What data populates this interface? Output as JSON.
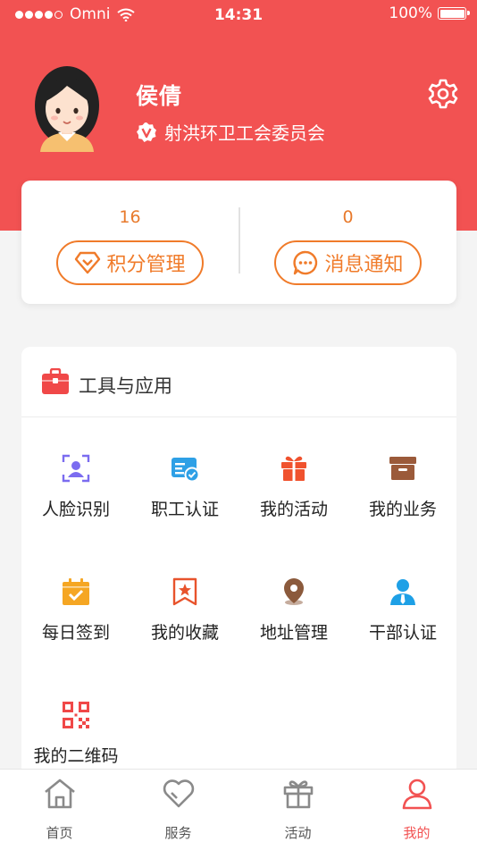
{
  "status_bar": {
    "carrier": "Omni",
    "time": "14:31",
    "battery": "100%"
  },
  "profile": {
    "name": "侯倩",
    "organization": "射洪环卫工会委员会"
  },
  "stats": [
    {
      "value": "16",
      "label": "积分管理",
      "icon": "diamond-icon"
    },
    {
      "value": "0",
      "label": "消息通知",
      "icon": "chat-bubble-icon"
    }
  ],
  "tools": {
    "title": "工具与应用",
    "items": [
      {
        "label": "人脸识别",
        "icon": "face-scan-icon",
        "color": "#7b6cf0"
      },
      {
        "label": "职工认证",
        "icon": "id-card-check-icon",
        "color": "#2ea0e6"
      },
      {
        "label": "我的活动",
        "icon": "gift-icon",
        "color": "#f0522e"
      },
      {
        "label": "我的业务",
        "icon": "archive-box-icon",
        "color": "#9b5a3a"
      },
      {
        "label": "每日签到",
        "icon": "calendar-check-icon",
        "color": "#f5a623"
      },
      {
        "label": "我的收藏",
        "icon": "star-bookmark-icon",
        "color": "#e8532c"
      },
      {
        "label": "地址管理",
        "icon": "location-pin-icon",
        "color": "#8b5a3c"
      },
      {
        "label": "干部认证",
        "icon": "person-tie-icon",
        "color": "#1ea0e6"
      },
      {
        "label": "我的二维码",
        "icon": "qr-code-icon",
        "color": "#f04848"
      }
    ]
  },
  "tabbar": [
    {
      "label": "首页",
      "icon": "home-icon",
      "active": false
    },
    {
      "label": "服务",
      "icon": "heart-icon",
      "active": false
    },
    {
      "label": "活动",
      "icon": "gift-box-icon",
      "active": false
    },
    {
      "label": "我的",
      "icon": "user-icon",
      "active": true
    }
  ],
  "colors": {
    "brand": "#f25252",
    "accent": "#f07b2a"
  }
}
